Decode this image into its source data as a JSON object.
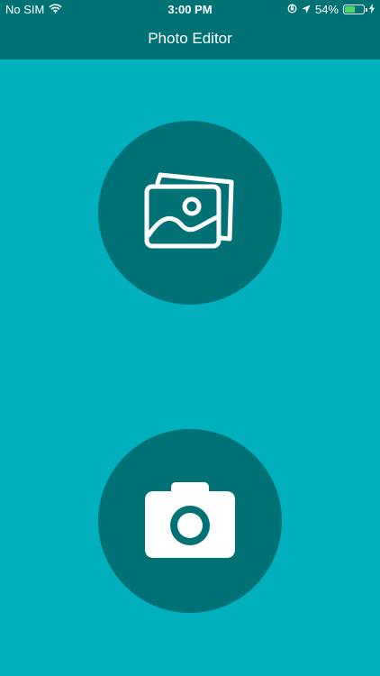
{
  "status_bar": {
    "carrier": "No SIM",
    "time": "3:00 PM",
    "battery_percent": "54%",
    "battery_level": 0.54
  },
  "nav": {
    "title": "Photo Editor"
  },
  "buttons": {
    "gallery_icon": "photo-gallery-icon",
    "camera_icon": "camera-icon"
  },
  "colors": {
    "background": "#00b0bd",
    "bar": "#007276",
    "button": "#007276",
    "icon": "#ffffff",
    "battery": "#4cd964"
  }
}
